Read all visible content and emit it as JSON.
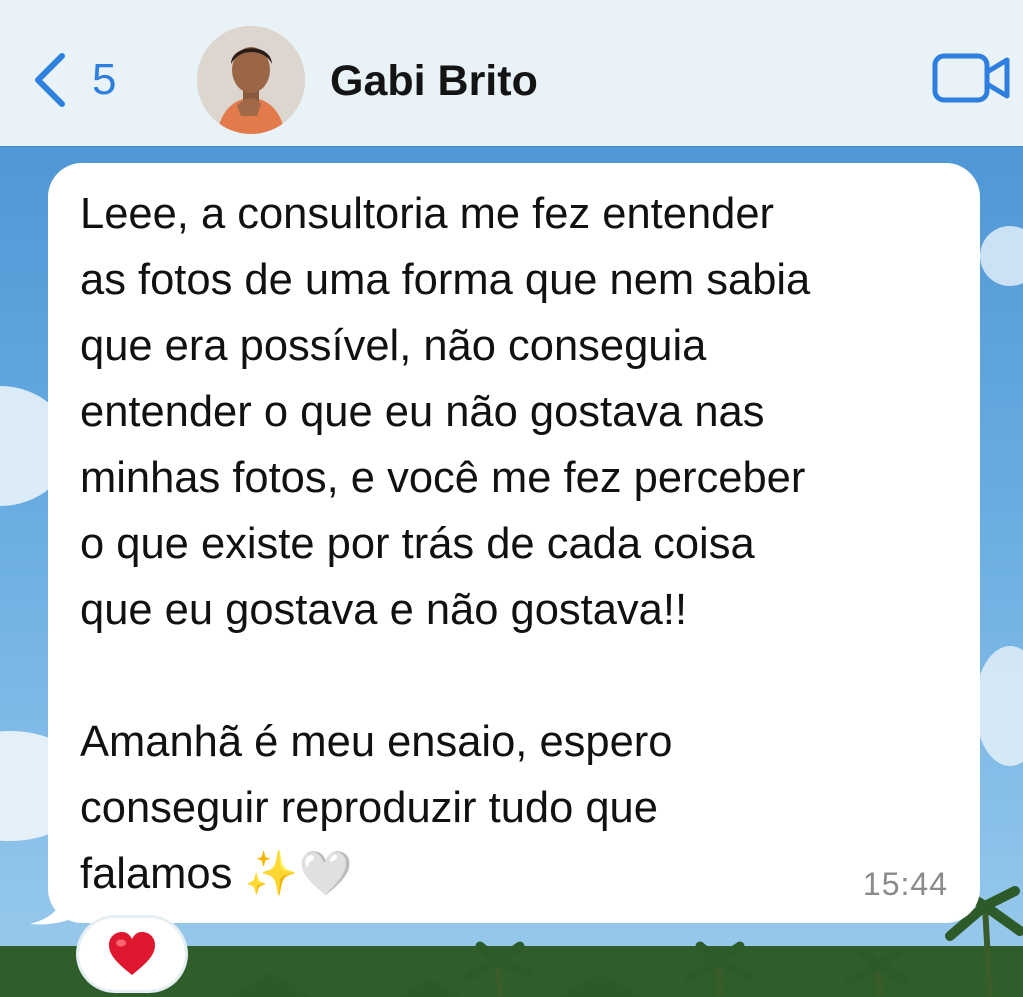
{
  "header": {
    "back_count": "5",
    "contact_name": "Gabi Brito"
  },
  "message": {
    "text": "Leee, a consultoria me fez entender\nas fotos de uma forma que nem sabia\nque era possível, não conseguia\nentender o que eu não gostava nas\nminhas fotos, e você me fez perceber\no que existe por trás de cada coisa\nque eu gostava e não gostava!!\n\nAmanhã é meu ensaio, espero\nconseguir reproduzir tudo que\nfalamos ✨🤍",
    "time": "15:44",
    "reaction": "❤️"
  },
  "colors": {
    "header_bg": "#e9f3f7",
    "accent_blue": "#2f7fe0",
    "bubble_bg": "#ffffff",
    "time_gray": "#8a8a8a"
  },
  "icons": [
    "chevron-left-icon",
    "video-camera-icon",
    "heart-icon"
  ]
}
